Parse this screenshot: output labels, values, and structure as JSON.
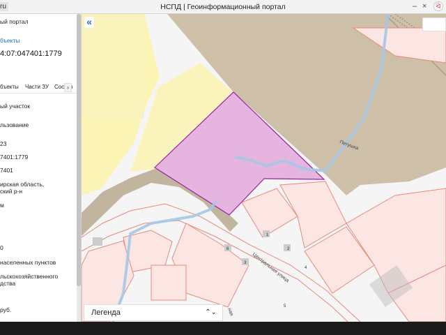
{
  "window": {
    "title": "НСПД | Геоинформационный портал",
    "url_stub": "ru",
    "ext_icon": "ᐛ"
  },
  "sidebar": {
    "portal_label": "ый портал",
    "objects_link": "бъекты",
    "cad_number": "4:07:047401:1779",
    "tabs": [
      "бъекты",
      "Части ЗУ",
      "Состав"
    ],
    "tab_arrow": "›",
    "fields": [
      "ый участок",
      "льзование",
      "23",
      "7401:1779",
      "7401",
      "ирская область,",
      "ский р-н",
      "м",
      "0",
      "населенных пунктов",
      "льскохозяйственного",
      "дства",
      "руб."
    ]
  },
  "map": {
    "street_1": "Петушка",
    "street_2": "Центральная улица",
    "street_3": "ная",
    "plot_numbers": [
      "1",
      "2",
      "3",
      "6",
      "4",
      "5"
    ],
    "colors": {
      "forest": "#cdbfa8",
      "selected_fill": "#e6b5df",
      "selected_stroke": "#9a1fa0",
      "yellow_zone": "#fbf3a8",
      "river": "#a6c6e6",
      "parcel_line": "#e58a7a",
      "parcel_fill": "#fbe6e4"
    }
  },
  "controls": {
    "collapse_icon": "«",
    "legend_label": "Легенда",
    "legend_chevron": "⌃⌄"
  }
}
